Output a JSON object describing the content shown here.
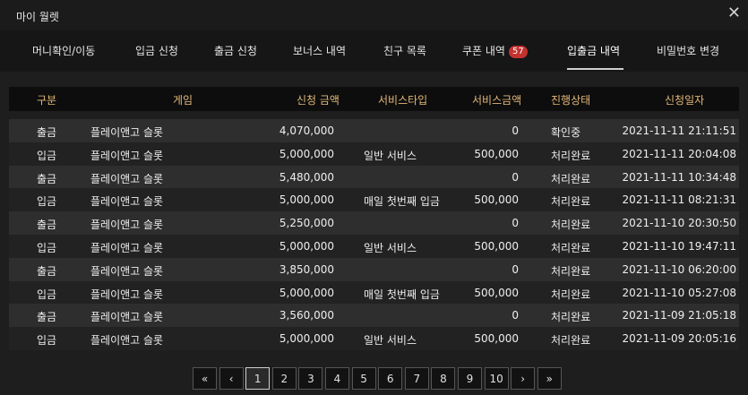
{
  "window": {
    "title": "마이 월렛",
    "close_label": "✕"
  },
  "tabs": [
    {
      "label": "머니확인/이동"
    },
    {
      "label": "입금 신청"
    },
    {
      "label": "출금 신청"
    },
    {
      "label": "보너스 내역"
    },
    {
      "label": "친구 목록"
    },
    {
      "label": "쿠폰 내역",
      "badge": "57"
    },
    {
      "label": "입출금 내역",
      "active": true
    },
    {
      "label": "비밀번호 변경"
    }
  ],
  "table": {
    "headers": [
      "구분",
      "게임",
      "신청 금액",
      "서비스타입",
      "서비스금액",
      "진행상태",
      "신청일자"
    ],
    "rows": [
      [
        "출금",
        "플레이앤고 슬롯",
        "4,070,000",
        "",
        "0",
        "확인중",
        "2021-11-11 21:11:51"
      ],
      [
        "입금",
        "플레이앤고 슬롯",
        "5,000,000",
        "일반 서비스",
        "500,000",
        "처리완료",
        "2021-11-11 20:04:08"
      ],
      [
        "출금",
        "플레이앤고 슬롯",
        "5,480,000",
        "",
        "0",
        "처리완료",
        "2021-11-11 10:34:48"
      ],
      [
        "입금",
        "플레이앤고 슬롯",
        "5,000,000",
        "매일 첫번째 입금",
        "500,000",
        "처리완료",
        "2021-11-11 08:21:31"
      ],
      [
        "출금",
        "플레이앤고 슬롯",
        "5,250,000",
        "",
        "0",
        "처리완료",
        "2021-11-10 20:30:50"
      ],
      [
        "입금",
        "플레이앤고 슬롯",
        "5,000,000",
        "일반 서비스",
        "500,000",
        "처리완료",
        "2021-11-10 19:47:11"
      ],
      [
        "출금",
        "플레이앤고 슬롯",
        "3,850,000",
        "",
        "0",
        "처리완료",
        "2021-11-10 06:20:00"
      ],
      [
        "입금",
        "플레이앤고 슬롯",
        "5,000,000",
        "매일 첫번째 입금",
        "500,000",
        "처리완료",
        "2021-11-10 05:27:08"
      ],
      [
        "출금",
        "플레이앤고 슬롯",
        "3,560,000",
        "",
        "0",
        "처리완료",
        "2021-11-09 21:05:18"
      ],
      [
        "입금",
        "플레이앤고 슬롯",
        "5,000,000",
        "일반 서비스",
        "500,000",
        "처리완료",
        "2021-11-09 20:05:16"
      ]
    ]
  },
  "pagination": {
    "items": [
      "«",
      "‹",
      "1",
      "2",
      "3",
      "4",
      "5",
      "6",
      "7",
      "8",
      "9",
      "10",
      "›",
      "»"
    ],
    "current": "1"
  }
}
